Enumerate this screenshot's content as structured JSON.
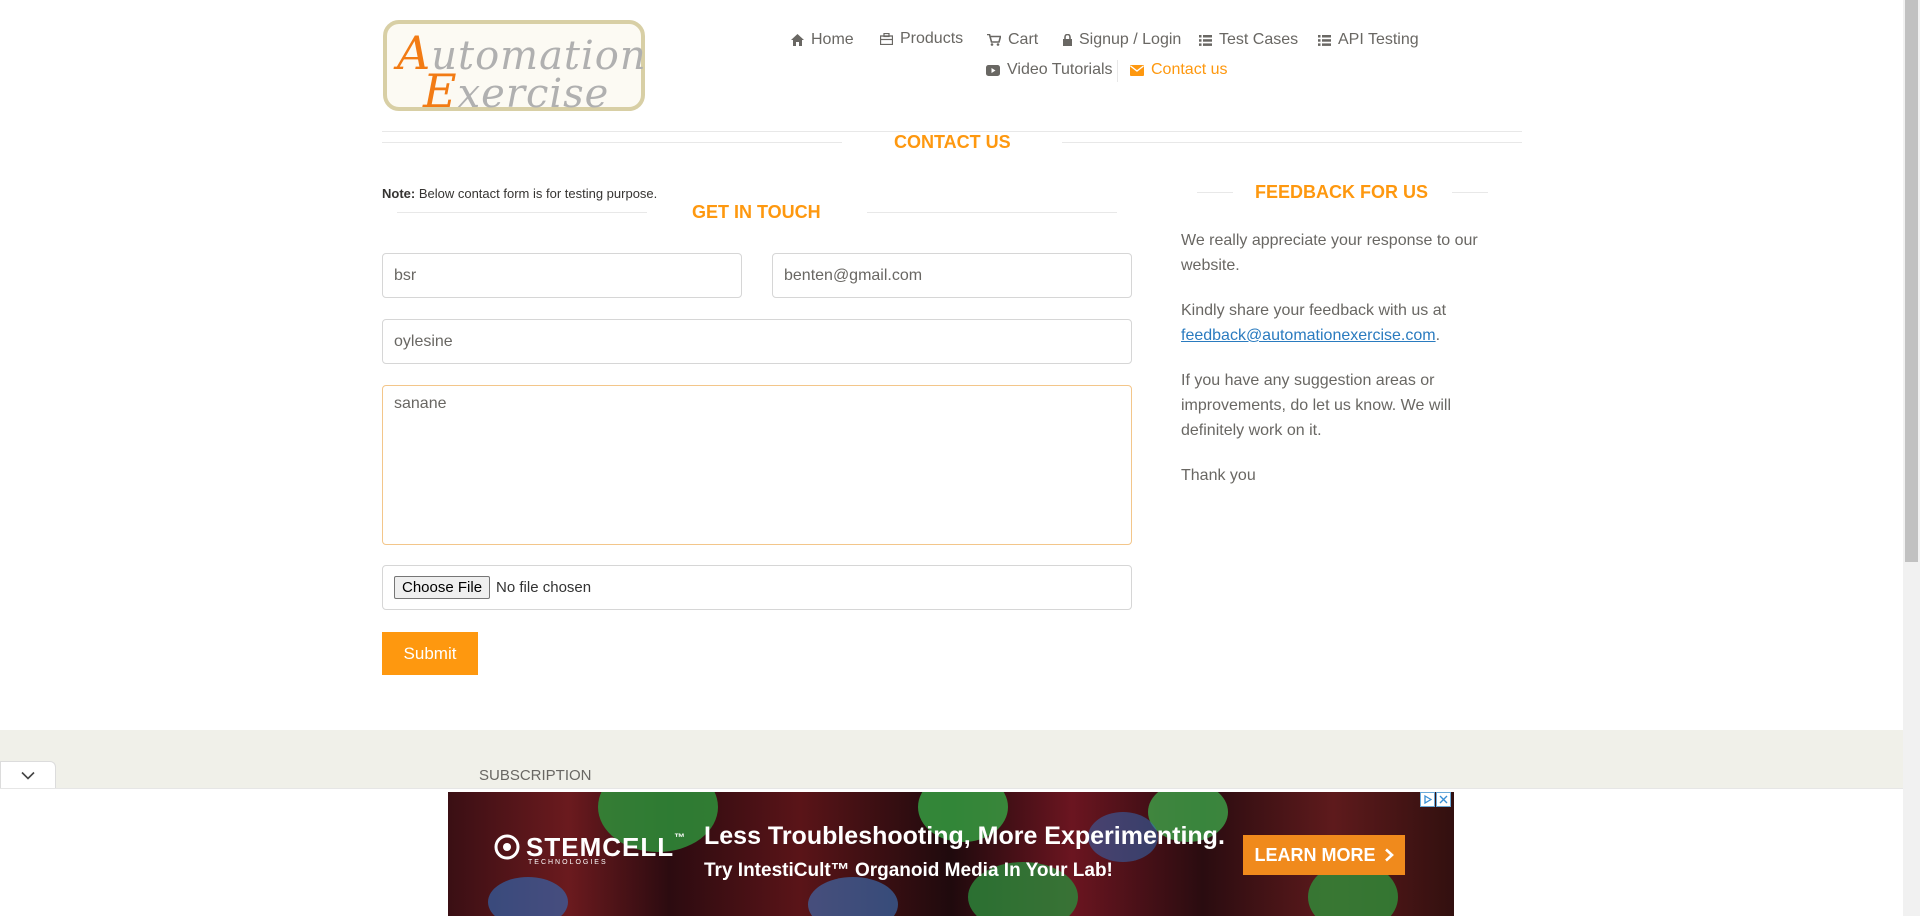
{
  "logo": {
    "line1_cap": "A",
    "line1_rest": "utomation",
    "line2_cap": "E",
    "line2_rest": "xercise"
  },
  "nav": {
    "home": "Home",
    "products": "Products",
    "cart": "Cart",
    "signup": "Signup / Login",
    "test_cases": "Test Cases",
    "api_testing": "API Testing",
    "video_tutorials": "Video Tutorials",
    "contact": "Contact us"
  },
  "page_title": "Contact Us",
  "note": {
    "label": "Note:",
    "text": " Below contact form is for testing purpose."
  },
  "form": {
    "title": "Get In Touch",
    "name_value": "bsr",
    "email_value": "benten@gmail.com",
    "subject_value": "oylesine",
    "message_value": "sanane",
    "choose_file_label": "Choose File",
    "file_status": "No file chosen",
    "submit_label": "Submit"
  },
  "feedback": {
    "title": "Feedback For Us",
    "p1": "We really appreciate your response to our website.",
    "p2_prefix": "Kindly share your feedback with us at ",
    "email": "feedback@automationexercise.com",
    "p2_suffix": ".",
    "p3": "If you have any suggestion areas or improvements, do let us know. We will definitely work on it.",
    "p4": "Thank you"
  },
  "footer": {
    "subscription": "Subscription"
  },
  "ad": {
    "brand": "STEMCELL",
    "brand_tm": "™",
    "brand_sub": "TECHNOLOGIES",
    "headline": "Less Troubleshooting, More Experimenting.",
    "subline": "Try IntestiCult™ Organoid Media In Your Lab!",
    "cta": "LEARN MORE"
  },
  "colors": {
    "accent": "#FE980F",
    "link": "#2a7bbf",
    "text": "#696763",
    "footer_bg": "#f0f0e9"
  }
}
